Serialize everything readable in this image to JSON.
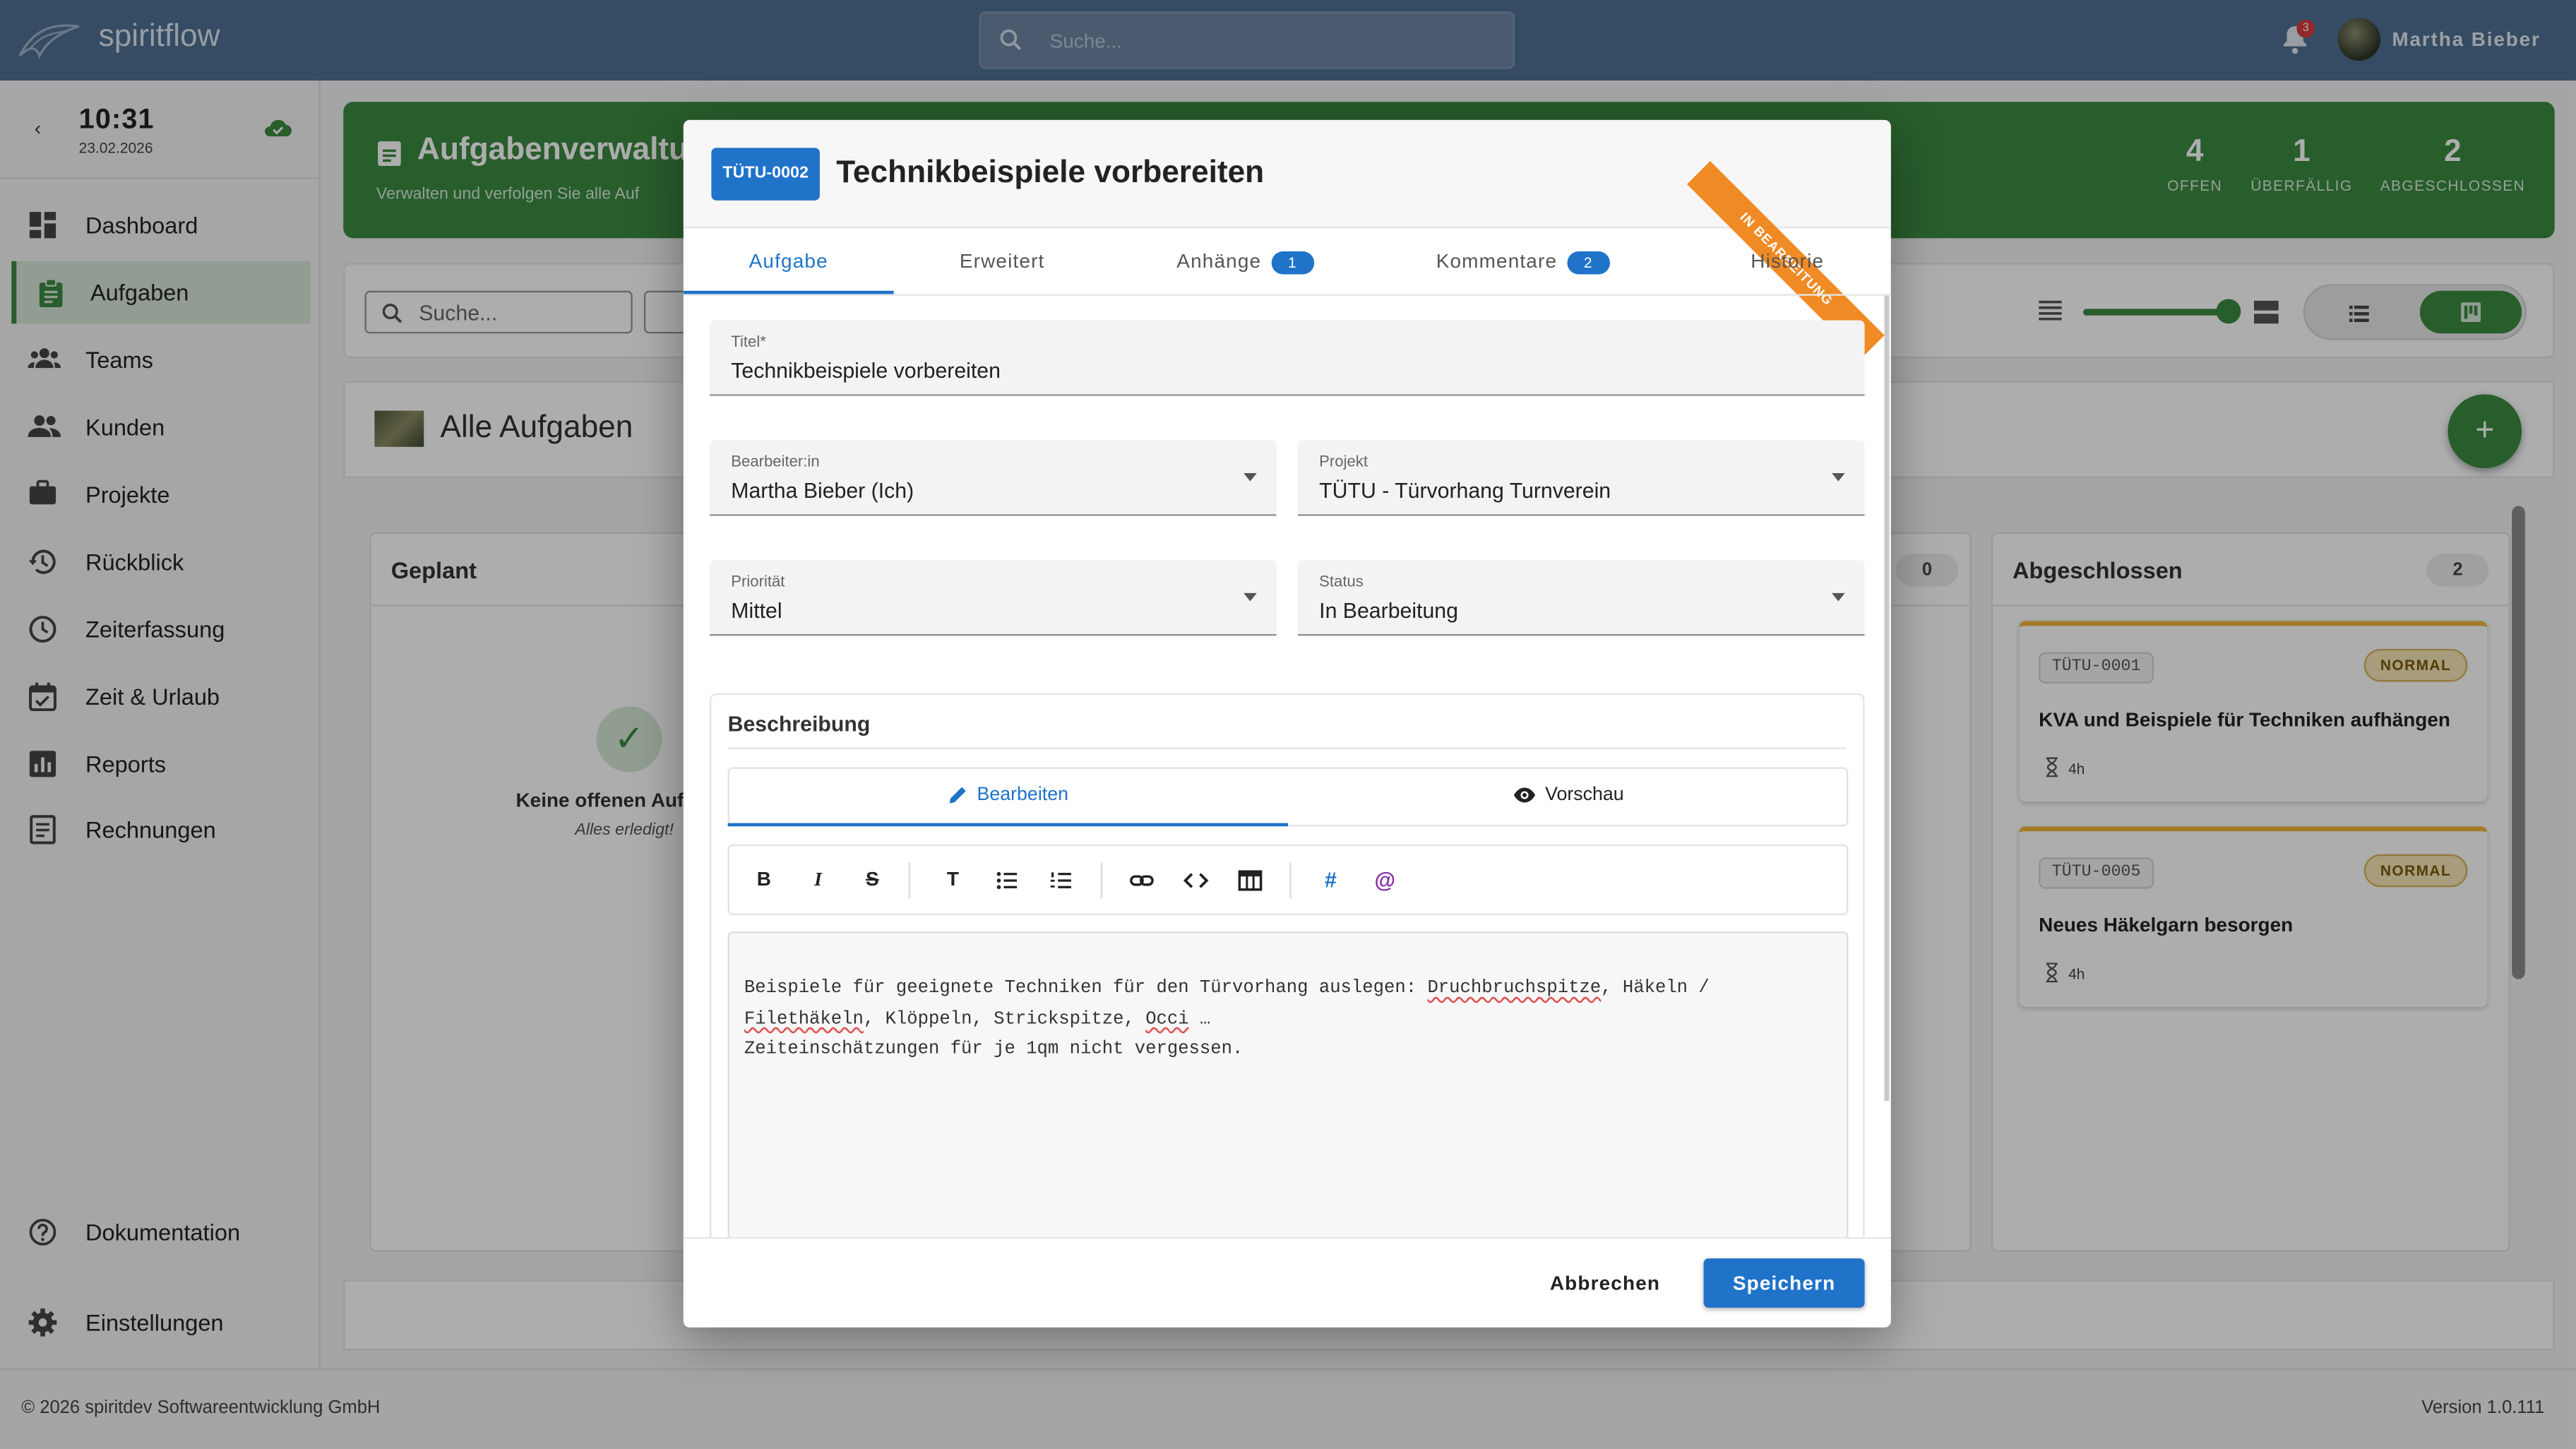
{
  "app": {
    "name": "spiritflow"
  },
  "topbar": {
    "search_placeholder": "Suche...",
    "notification_count": "3",
    "user_name": "Martha Bieber"
  },
  "sidebar": {
    "time": "10:31",
    "date": "23.02.2026",
    "items": [
      {
        "label": "Dashboard",
        "icon": "dashboard-icon"
      },
      {
        "label": "Aufgaben",
        "icon": "clipboard-icon",
        "active": true
      },
      {
        "label": "Teams",
        "icon": "groups-icon"
      },
      {
        "label": "Kunden",
        "icon": "people-icon"
      },
      {
        "label": "Projekte",
        "icon": "briefcase-icon"
      },
      {
        "label": "Rückblick",
        "icon": "history-icon"
      },
      {
        "label": "Zeiterfassung",
        "icon": "clock-icon"
      },
      {
        "label": "Zeit & Urlaub",
        "icon": "calendar-check-icon"
      },
      {
        "label": "Reports",
        "icon": "chart-icon"
      },
      {
        "label": "Rechnungen",
        "icon": "receipt-icon"
      }
    ],
    "bottom_items": [
      {
        "label": "Dokumentation",
        "icon": "help-icon"
      },
      {
        "label": "Einstellungen",
        "icon": "gear-icon"
      }
    ]
  },
  "header": {
    "title": "Aufgabenverwaltu",
    "subtitle": "Verwalten und verfolgen Sie alle Auf",
    "stats": [
      {
        "value": "4",
        "label": "OFFEN"
      },
      {
        "value": "1",
        "label": "ÜBERFÄLLIG"
      },
      {
        "value": "2",
        "label": "ABGESCHLOSSEN"
      }
    ]
  },
  "toolbar": {
    "search_placeholder": "Suche..."
  },
  "list": {
    "title": "Alle Aufgaben",
    "add_label": "+"
  },
  "columns": {
    "planned": {
      "title": "Geplant",
      "empty_title": "Keine offenen Auf",
      "empty_sub": "Alles erledigt!"
    },
    "hidden_count": "0",
    "done": {
      "title": "Abgeschlossen",
      "count": "2",
      "cards": [
        {
          "id": "TÜTU-0001",
          "priority": "NORMAL",
          "title": "KVA und Beispiele für Techniken aufhängen",
          "hours": "4h"
        },
        {
          "id": "TÜTU-0005",
          "priority": "NORMAL",
          "title": "Neues Häkelgarn besorgen",
          "hours": "4h"
        }
      ]
    }
  },
  "dialog": {
    "task_id": "TÜTU-0002",
    "title": "Technikbeispiele vorbereiten",
    "ribbon": "IN BEARBEITUNG",
    "tabs": [
      {
        "label": "Aufgabe"
      },
      {
        "label": "Erweitert"
      },
      {
        "label": "Anhänge",
        "count": "1"
      },
      {
        "label": "Kommentare",
        "count": "2"
      },
      {
        "label": "Historie"
      }
    ],
    "fields": {
      "title": {
        "label": "Titel*",
        "value": "Technikbeispiele vorbereiten"
      },
      "assignee": {
        "label": "Bearbeiter:in",
        "value": "Martha Bieber (Ich)"
      },
      "project": {
        "label": "Projekt",
        "value": "TÜTU - Türvorhang Turnverein"
      },
      "priority": {
        "label": "Priorität",
        "value": "Mittel"
      },
      "status": {
        "label": "Status",
        "value": "In Bearbeitung"
      }
    },
    "description": {
      "title": "Beschreibung",
      "edit_label": "Bearbeiten",
      "preview_label": "Vorschau",
      "line1_a": "Beispiele für geeignete Techniken für den Türvorhang auslegen: ",
      "line1_b": "Druchbruchspitze",
      "line1_c": ", Häkeln /",
      "line2_a": "Filethäkeln",
      "line2_b": ", Klöppeln, Strickspitze, ",
      "line2_c": "Occi",
      "line2_d": " …",
      "line3": "Zeiteinschätzungen für je 1qm nicht vergessen."
    },
    "cancel_label": "Abbrechen",
    "save_label": "Speichern"
  },
  "footer": {
    "copyright": "© 2026 spiritdev Softwareentwicklung GmbH",
    "version": "Version 1.0.111"
  },
  "colors": {
    "primary_green": "#3b8a41",
    "topbar": "#4f7094",
    "accent_blue": "#1f73c9",
    "ribbon_orange": "#f08a24"
  }
}
